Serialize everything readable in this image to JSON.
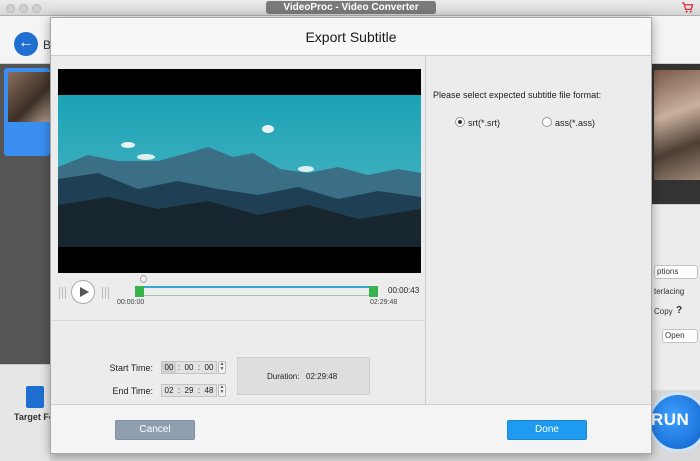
{
  "app": {
    "window_title": "VideoProc - Video Converter",
    "back_label": "B",
    "target_format_label": "Target For",
    "run_label": "RUN",
    "cart_icon": "cart-icon",
    "right_panel": {
      "options_label": "ptions",
      "deinterlacing_label": "terlacing",
      "copy_label": "Copy",
      "help_glyph": "?",
      "open_label": "Open"
    }
  },
  "dialog": {
    "title": "Export Subtitle",
    "player": {
      "start_marker": "00:00:00",
      "end_marker": "02:29:48",
      "current_time": "00:00:43",
      "play_icon": "play-icon"
    },
    "start_time": {
      "label": "Start Time:",
      "h": "00",
      "m": "00",
      "s": "00"
    },
    "end_time": {
      "label": "End Time:",
      "h": "02",
      "m": "29",
      "s": "48"
    },
    "duration": {
      "label": "Duration:",
      "value": "02:29:48"
    },
    "format": {
      "prompt": "Please select expected subtitle file format:",
      "options": [
        {
          "label": "srt(*.srt)",
          "selected": true
        },
        {
          "label": "ass(*.ass)",
          "selected": false
        }
      ]
    },
    "buttons": {
      "cancel": "Cancel",
      "done": "Done"
    }
  },
  "colors": {
    "accent": "#1e9bf0",
    "timeline_handle": "#37b24d",
    "timeline_bar": "#3aa7d9",
    "cancel_button": "#8f9fb0"
  }
}
